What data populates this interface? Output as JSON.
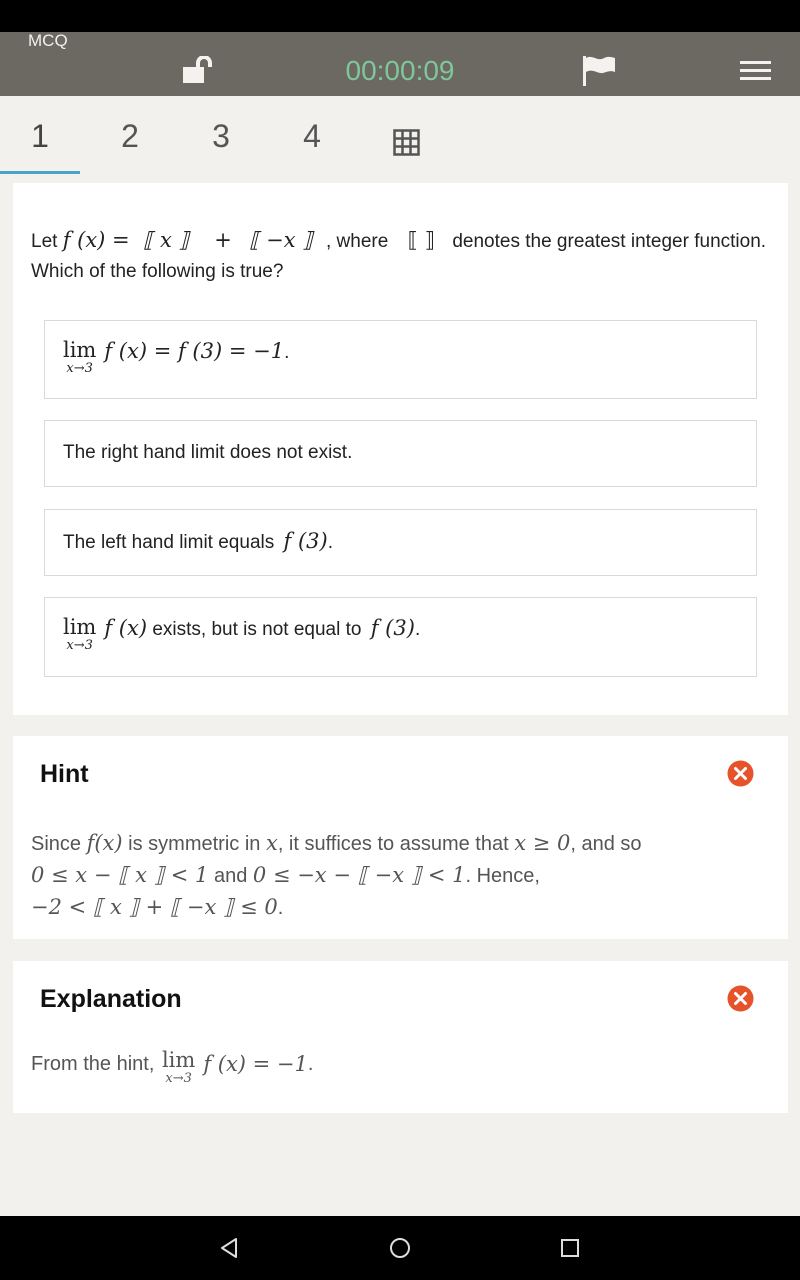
{
  "app_bar": {
    "title": "MCQ",
    "timer": "00:00:09",
    "colors": {
      "background": "#6c6862",
      "timer": "#7ec79a"
    },
    "icons": [
      "unlock-icon",
      "flag-icon",
      "menu-icon"
    ]
  },
  "tabs": {
    "items": [
      "1",
      "2",
      "3",
      "4"
    ],
    "active": "1",
    "grid_icon": "grid-icon",
    "accent": "#4aa3c9"
  },
  "question": {
    "lead": "Let",
    "fx": "f (x) =",
    "floor_x": "⟦ x ⟧",
    "plus": "+",
    "floor_neg_x": "⟦ −x ⟧",
    "where": ", where",
    "brackets": "⟦ ⟧",
    "denotes": "denotes the greatest integer function. Which of the following is true?"
  },
  "options": [
    {
      "lim": "lim",
      "sub": "x→3",
      "expr": "f (x) = f (3) = −1",
      "tail": "."
    },
    {
      "text": "The right hand limit does not exist."
    },
    {
      "text": "The left hand limit equals",
      "expr": "f (3)",
      "tail": "."
    },
    {
      "lim": "lim",
      "sub": "x→3",
      "expr": "f (x)",
      "text": "exists, but is not equal to",
      "expr2": "f (3)",
      "tail": "."
    }
  ],
  "hint": {
    "title": "Hint",
    "close_icon": "close-icon",
    "l1_a": "Since",
    "l1_fx": "f(x)",
    "l1_b": "is symmetric in",
    "l1_x": "x",
    "l1_c": ", it suffices to assume that",
    "l1_ineq": "x ≥ 0",
    "l1_d": ", and so",
    "l2_a": "0 ≤ x −  ⟦ x ⟧  < 1",
    "l2_and": "and",
    "l2_b": "0 ≤ −x − ⟦ −x ⟧  < 1",
    "l2_c": ". Hence,",
    "l3": "−2 <  ⟦ x ⟧  +  ⟦ −x ⟧  ≤ 0",
    "l3_tail": "."
  },
  "explanation": {
    "title": "Explanation",
    "close_icon": "close-icon",
    "lead": "From the hint,",
    "lim": "lim",
    "sub": "x→3",
    "expr": "f (x) = −1",
    "tail": "."
  },
  "nav": {
    "icons": [
      "back-icon",
      "home-icon",
      "recent-apps-icon"
    ]
  }
}
